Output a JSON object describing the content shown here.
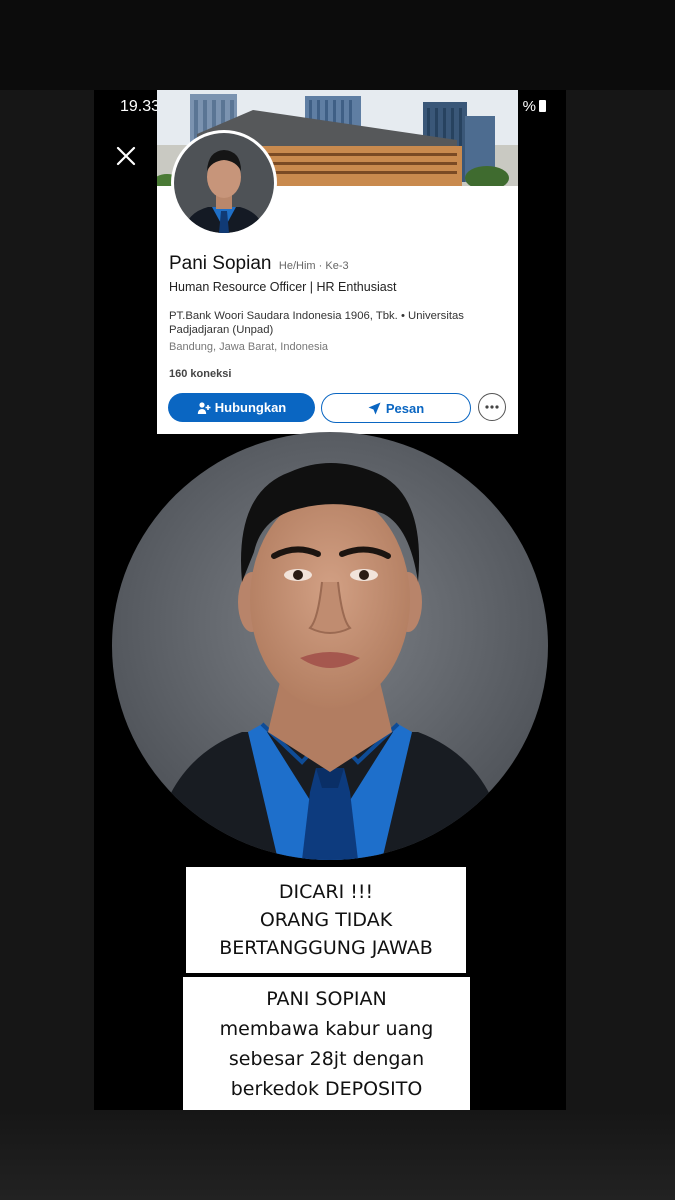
{
  "status_bar": {
    "time": "19.33",
    "battery_suffix": "%"
  },
  "profile": {
    "name": "Pani Sopian",
    "pronouns": "He/Him · Ke-3",
    "headline": "Human Resource Officer | HR Enthusiast",
    "company": "PT.Bank Woori Saudara Indonesia 1906, Tbk. • Universitas Padjadjaran (Unpad)",
    "location": "Bandung, Jawa Barat, Indonesia",
    "connections": "160 koneksi",
    "connect_label": "Hubungkan",
    "message_label": "Pesan",
    "accent_color": "#0a66c2"
  },
  "notice": {
    "line1": "DICARI !!!",
    "line2": "ORANG TIDAK",
    "line3": "BERTANGGUNG JAWAB"
  },
  "notice_detail": {
    "line1": "PANI SOPIAN",
    "line2": "membawa kabur uang",
    "line3": "sebesar 28jt dengan",
    "line4": "berkedok DEPOSITO"
  },
  "icons": {
    "close": "close-icon",
    "connect": "add-person-icon",
    "message": "send-icon",
    "more": "more-horizontal-icon",
    "battery": "battery-icon"
  }
}
